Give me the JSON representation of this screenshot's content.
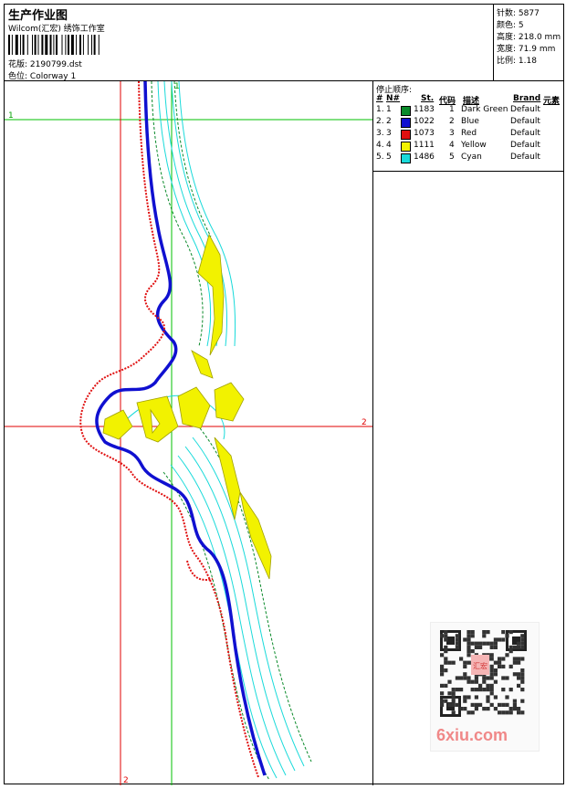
{
  "header": {
    "title": "生产作业图",
    "subtitle": "Wilcom(汇宏) 绣饰工作室",
    "design_label": "花版:",
    "design_value": "2190799.dst",
    "colorway_label": "色位:",
    "colorway_value": "Colorway 1"
  },
  "stats": [
    {
      "label": "针数:",
      "value": "5877"
    },
    {
      "label": "颜色:",
      "value": "5"
    },
    {
      "label": "高度:",
      "value": "218.0 mm"
    },
    {
      "label": "宽度:",
      "value": "71.9 mm"
    },
    {
      "label": "比例:",
      "value": "1.18"
    }
  ],
  "stop_sequence": {
    "title": "停止顺序:",
    "columns": [
      "#",
      "N#",
      "St.",
      "代码",
      "描述",
      "Brand",
      "元素"
    ],
    "rows": [
      {
        "num": "1.",
        "n": "1",
        "stitches": "1183",
        "code": "1",
        "desc": "Dark Green",
        "brand": "Default",
        "color": "#0a8a2a"
      },
      {
        "num": "2.",
        "n": "2",
        "stitches": "1022",
        "code": "2",
        "desc": "Blue",
        "brand": "Default",
        "color": "#1010d0"
      },
      {
        "num": "3.",
        "n": "3",
        "stitches": "1073",
        "code": "3",
        "desc": "Red",
        "brand": "Default",
        "color": "#e01010"
      },
      {
        "num": "4.",
        "n": "4",
        "stitches": "1111",
        "code": "4",
        "desc": "Yellow",
        "brand": "Default",
        "color": "#f2f200"
      },
      {
        "num": "5.",
        "n": "5",
        "stitches": "1486",
        "code": "5",
        "desc": "Cyan",
        "brand": "Default",
        "color": "#19dada"
      }
    ]
  },
  "guides": {
    "h1": "1",
    "v1": "1",
    "h2": "2",
    "v2": "2"
  },
  "watermark": {
    "text": "6xiu.com",
    "stamp": "汇宏"
  }
}
